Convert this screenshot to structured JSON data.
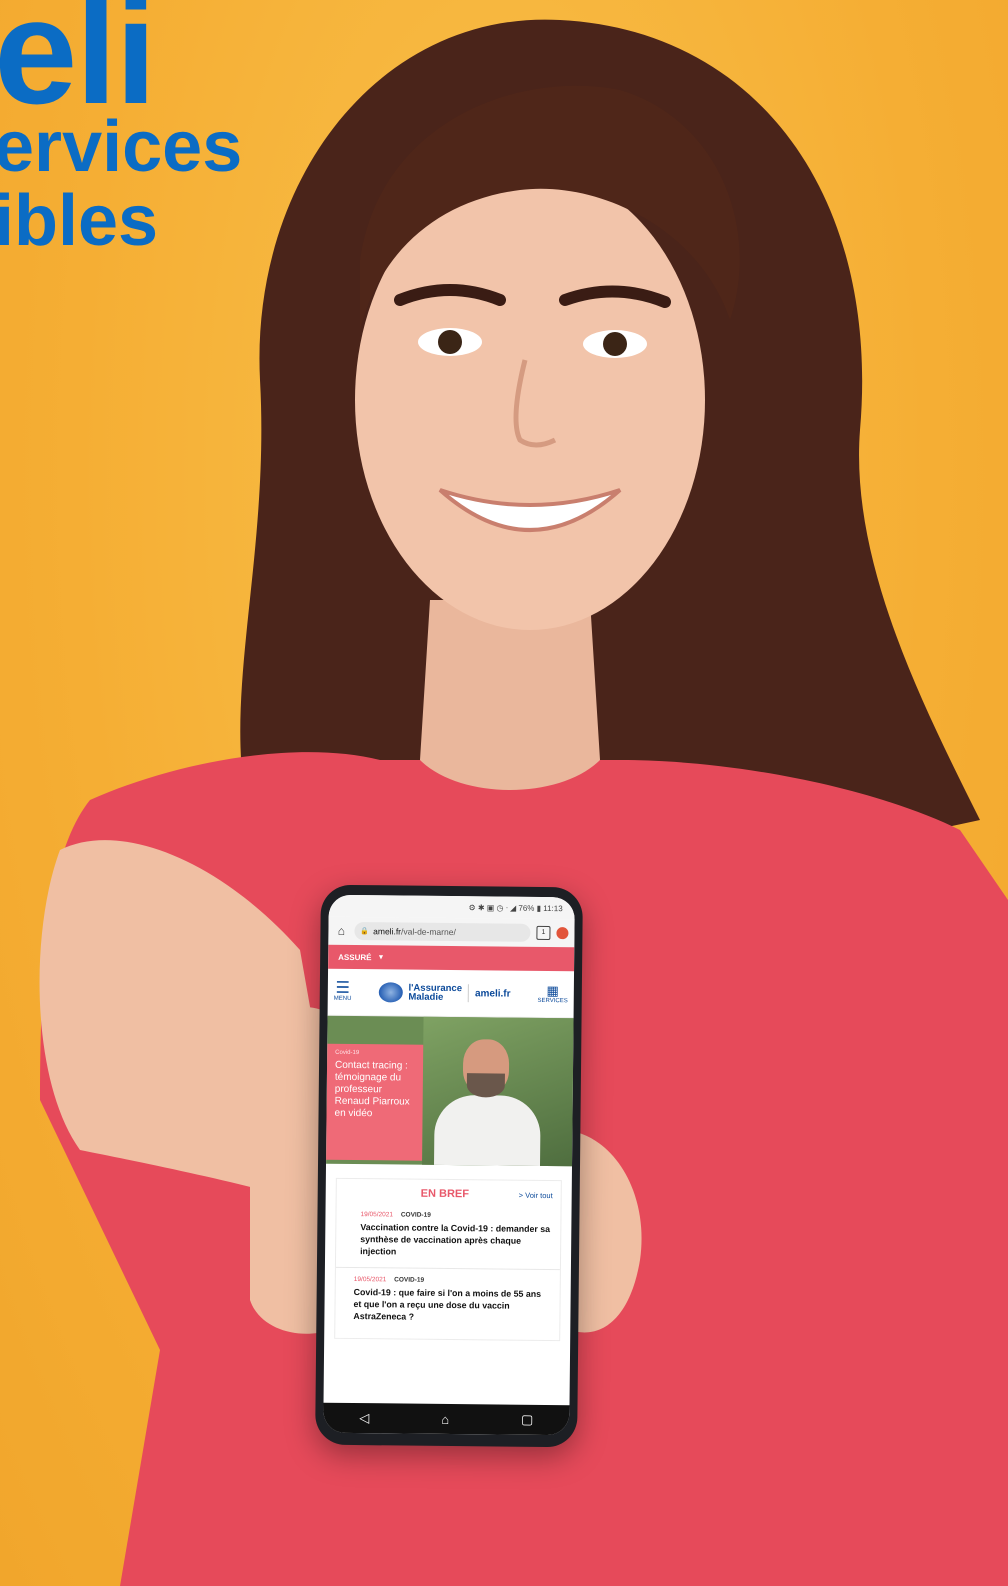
{
  "headline": {
    "brand": "eli",
    "line1": "ervices",
    "line2": "ibles"
  },
  "phone": {
    "status": "⚙ ✱ ▣ ◷ ᐧ ◢ 76% ▮ 11:13",
    "url_host": "ameli.fr",
    "url_path": "/val-de-marne/",
    "tab_count": "1",
    "assure_label": "ASSURÉ",
    "menu_label": "MENU",
    "logo_name_1": "l'Assurance",
    "logo_name_2": "Maladie",
    "logo_ameli": "ameli.fr",
    "services_label": "SERVICES",
    "hero": {
      "kicker": "Covid-19",
      "title": "Contact tracing : témoignage du professeur Renaud Piarroux en vidéo"
    },
    "brief": {
      "title": "EN BREF",
      "see_all": "> Voir tout",
      "items": [
        {
          "date": "19/05/2021",
          "tag": "COVID-19",
          "title": "Vaccination contre la Covid-19 : demander sa synthèse de vaccination après chaque injection"
        },
        {
          "date": "19/05/2021",
          "tag": "COVID-19",
          "title": "Covid-19 : que faire si l'on a moins de 55 ans et que l'on a reçu une dose du vaccin AstraZeneca ?"
        }
      ]
    },
    "nav": {
      "back": "◁",
      "home": "⌂",
      "recents": "▢"
    }
  },
  "colors": {
    "background": "#f5ae34",
    "headline_blue": "#0b6cc4",
    "shirt": "#e64a5a",
    "accent_pink": "#e8586a"
  }
}
